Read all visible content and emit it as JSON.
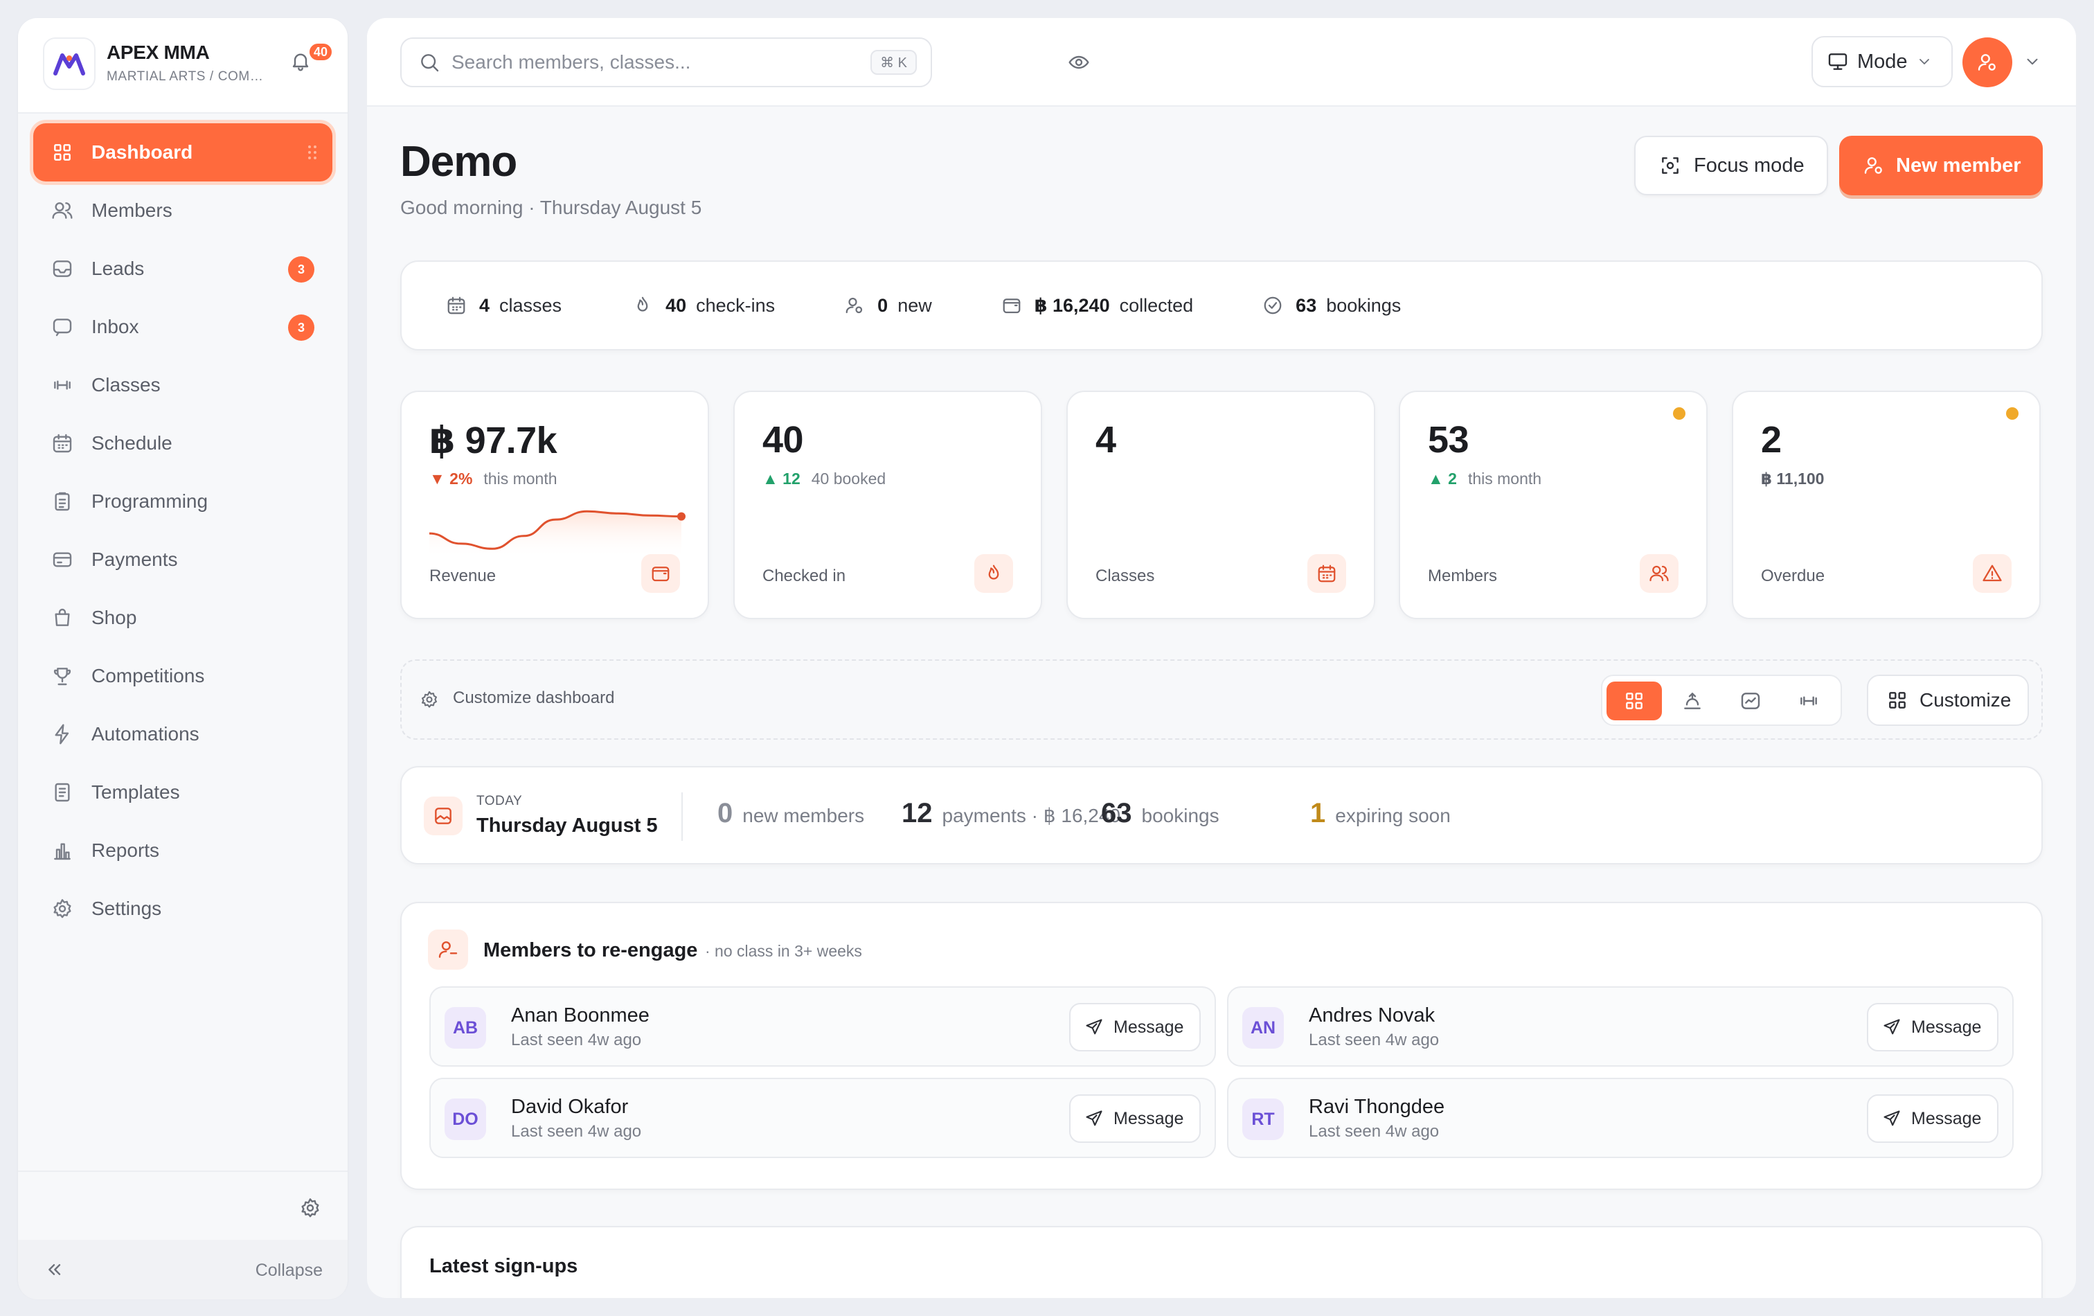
{
  "brand": {
    "name": "APEX MMA",
    "subtitle": "MARTIAL ARTS / COMMUNITY",
    "notifications": "40"
  },
  "nav": [
    {
      "label": "Dashboard",
      "icon": "grid-icon",
      "active": true
    },
    {
      "label": "Members",
      "icon": "users-icon"
    },
    {
      "label": "Leads",
      "icon": "inbox-tray-icon",
      "badge": "3"
    },
    {
      "label": "Inbox",
      "icon": "chat-icon",
      "badge": "3"
    },
    {
      "label": "Classes",
      "icon": "dumbbell-icon"
    },
    {
      "label": "Schedule",
      "icon": "calendar-icon"
    },
    {
      "label": "Programming",
      "icon": "clipboard-icon"
    },
    {
      "label": "Payments",
      "icon": "credit-card-icon"
    },
    {
      "label": "Shop",
      "icon": "shopping-bag-icon"
    },
    {
      "label": "Competitions",
      "icon": "trophy-icon"
    },
    {
      "label": "Automations",
      "icon": "lightning-icon"
    },
    {
      "label": "Templates",
      "icon": "document-icon"
    },
    {
      "label": "Reports",
      "icon": "bar-chart-icon"
    },
    {
      "label": "Settings",
      "icon": "gear-icon"
    }
  ],
  "sidebar_footer": {
    "collapse_label": "Collapse"
  },
  "topbar": {
    "search_placeholder": "Search members, classes...",
    "search_shortcut": "⌘ K",
    "mode_label": "Mode"
  },
  "header": {
    "title": "Demo",
    "subtitle": "Good morning · Thursday August 5",
    "focus_label": "Focus mode",
    "new_member_label": "New member"
  },
  "stats": [
    {
      "value": "4",
      "label": "classes",
      "icon": "calendar-icon"
    },
    {
      "value": "40",
      "label": "check-ins",
      "icon": "flame-icon"
    },
    {
      "value": "0",
      "label": "new",
      "icon": "user-plus-icon"
    },
    {
      "value": "฿ 16,240",
      "label": "collected",
      "icon": "wallet-icon"
    },
    {
      "value": "63",
      "label": "bookings",
      "icon": "check-circle-icon"
    }
  ],
  "kpis": [
    {
      "value": "฿ 97.7k",
      "delta": "2%",
      "direction": "down",
      "note": "this month",
      "label": "Revenue",
      "icon": "wallet-icon",
      "dot": false
    },
    {
      "value": "40",
      "delta": "12",
      "direction": "up",
      "note": "40 booked",
      "label": "Checked in",
      "icon": "flame-icon",
      "dot": false
    },
    {
      "value": "4",
      "delta": "",
      "direction": "",
      "note": "",
      "label": "Classes",
      "icon": "calendar-icon",
      "dot": false
    },
    {
      "value": "53",
      "delta": "2",
      "direction": "up",
      "note": "this month",
      "label": "Members",
      "icon": "users-icon",
      "dot": true
    },
    {
      "value": "2",
      "delta": "",
      "direction": "",
      "note": "฿ 11,100",
      "label": "Overdue",
      "icon": "warning-icon",
      "dot": true
    }
  ],
  "revenue_trend": [
    0.35,
    0.15,
    0.05,
    0.3,
    0.62,
    0.78,
    0.74,
    0.7,
    0.68
  ],
  "customize": {
    "label": "Customize dashboard",
    "button_label": "Customize"
  },
  "today": {
    "kicker": "TODAY",
    "date": "Thursday August 5",
    "items": [
      {
        "value": "0",
        "label": "new members",
        "color": "#8a8e98"
      },
      {
        "value": "12",
        "label": "payments · ฿ 16,240",
        "color": "#2b2d33"
      },
      {
        "value": "63",
        "label": "bookings",
        "color": "#2b2d33"
      },
      {
        "value": "1",
        "label": "expiring soon",
        "color": "#c08a1a"
      }
    ]
  },
  "reengage": {
    "title": "Members to re-engage",
    "subtitle": "· no class in 3+ weeks",
    "message_label": "Message",
    "members": [
      {
        "initials": "AB",
        "name": "Anan Boonmee",
        "seen": "Last seen 4w ago"
      },
      {
        "initials": "AN",
        "name": "Andres Novak",
        "seen": "Last seen 4w ago"
      },
      {
        "initials": "DO",
        "name": "David Okafor",
        "seen": "Last seen 4w ago"
      },
      {
        "initials": "RT",
        "name": "Ravi Thongdee",
        "seen": "Last seen 4w ago"
      }
    ]
  },
  "signups": {
    "title": "Latest sign-ups"
  }
}
